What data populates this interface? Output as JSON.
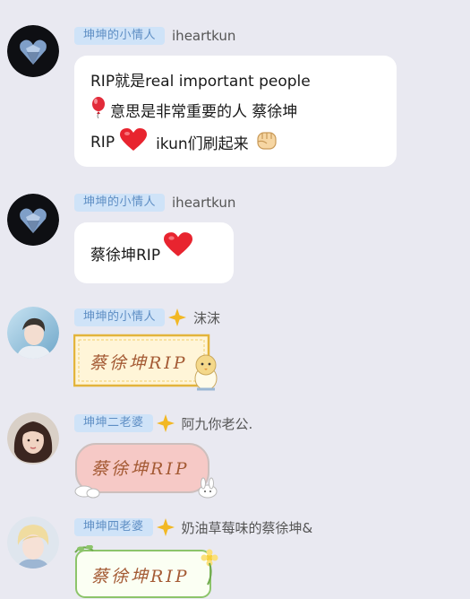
{
  "messages": [
    {
      "badge": "坤坤的小情人",
      "username": "iheartkun",
      "avatar": "dark-heart-avatar",
      "lines": [
        "RIP就是real important people",
        "意思是非常重要的人 蔡徐坤",
        "RIP",
        "ikun们刷起来"
      ],
      "icons": [
        "balloon-icon",
        "red-heart-icon",
        "fist-icon"
      ]
    },
    {
      "badge": "坤坤的小情人",
      "username": "iheartkun",
      "avatar": "dark-heart-avatar",
      "text": "蔡徐坤RIP",
      "icons": [
        "red-heart-icon"
      ]
    },
    {
      "badge": "坤坤的小情人",
      "username": "沫沫",
      "avatar": "boy-photo-avatar",
      "sticker_text": "蔡徐坤RIP",
      "sticker_style": "yellow-frame"
    },
    {
      "badge": "坤坤二老婆",
      "username": "阿九你老公.",
      "avatar": "girl-photo-avatar",
      "sticker_text": "蔡徐坤RIP",
      "sticker_style": "pink-cloud"
    },
    {
      "badge": "坤坤四老婆",
      "username": "奶油草莓味的蔡徐坤&",
      "avatar": "blond-photo-avatar",
      "sticker_text": "蔡徐坤RIP",
      "sticker_style": "green-vine"
    }
  ],
  "colors": {
    "background": "#e9e9f1",
    "badge_bg": "#cfe3f8",
    "badge_text": "#5e8ec4",
    "bubble": "#ffffff",
    "heart": "#e8242f",
    "star": "#f2b824"
  }
}
